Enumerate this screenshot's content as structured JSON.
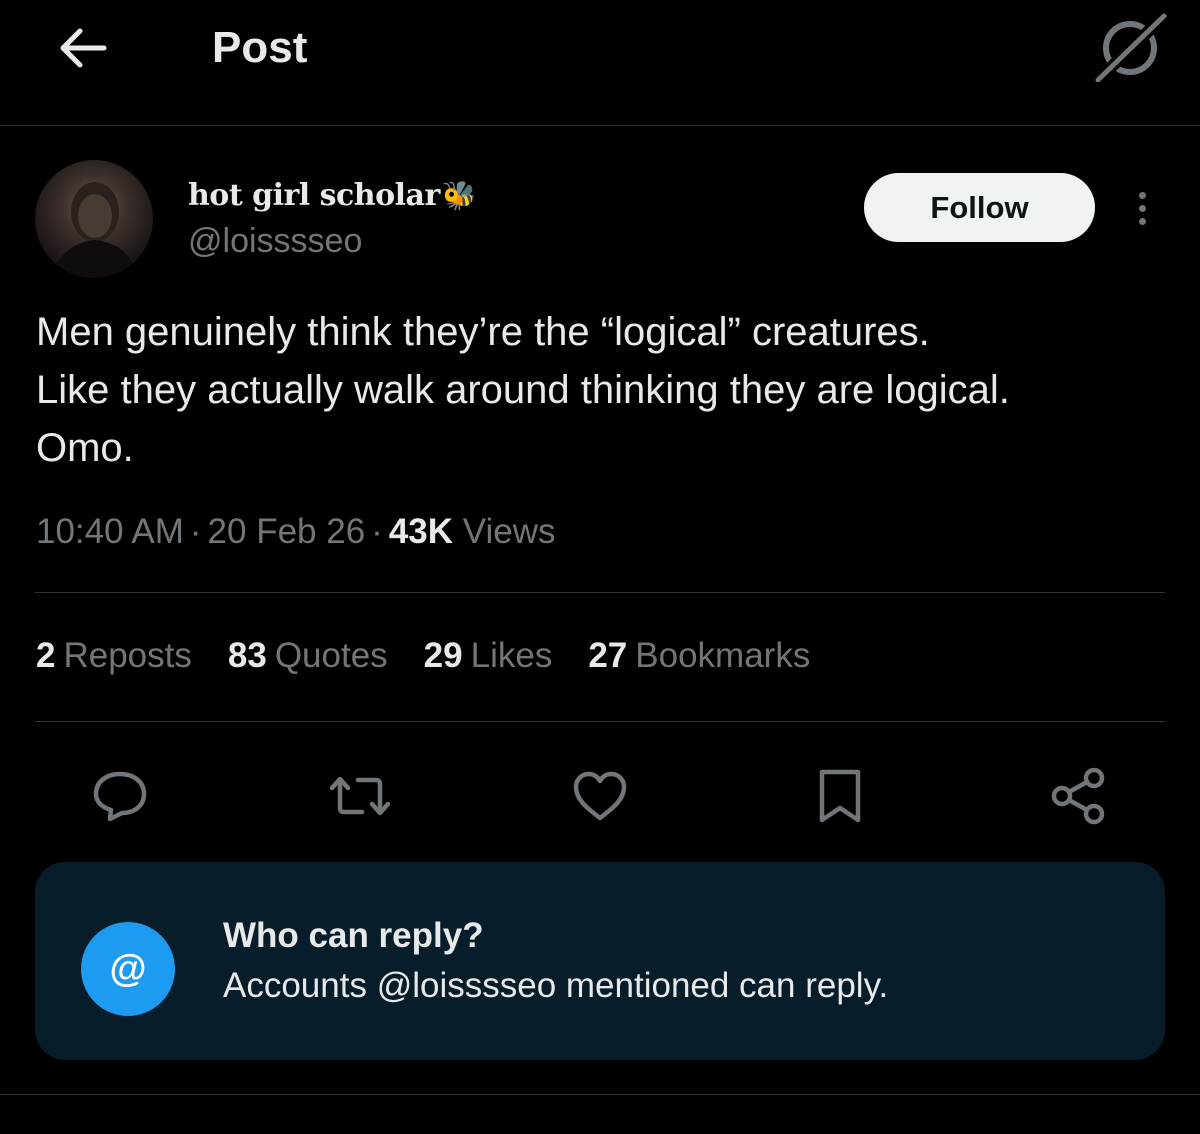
{
  "header": {
    "title": "Post",
    "back_icon": "arrow-left-icon",
    "grok_icon": "grok-icon"
  },
  "author": {
    "display_name": "hot girl scholar",
    "name_emoji": "🐝",
    "handle": "@loisssseo",
    "follow_label": "Follow"
  },
  "post": {
    "lines": [
      "Men genuinely think they’re the “logical” creatures.",
      "Like they actually walk around thinking they are logical.",
      "Omo."
    ],
    "time": "10:40 AM",
    "date": "20 Feb 26",
    "views_count": "43K",
    "views_label": "Views",
    "separator": "·"
  },
  "stats": [
    {
      "count": "2",
      "label": "Reposts"
    },
    {
      "count": "83",
      "label": "Quotes"
    },
    {
      "count": "29",
      "label": "Likes"
    },
    {
      "count": "27",
      "label": "Bookmarks"
    }
  ],
  "actions": [
    "reply-icon",
    "repost-icon",
    "like-icon",
    "bookmark-icon",
    "share-icon"
  ],
  "reply_settings": {
    "icon": "@",
    "title": "Who can reply?",
    "description": "Accounts @loisssseo mentioned can reply."
  },
  "colors": {
    "background": "#000000",
    "text_primary": "#e7e9ea",
    "text_secondary": "#71767b",
    "accent": "#1d9bf0",
    "reply_box_bg": "#071d2a"
  }
}
